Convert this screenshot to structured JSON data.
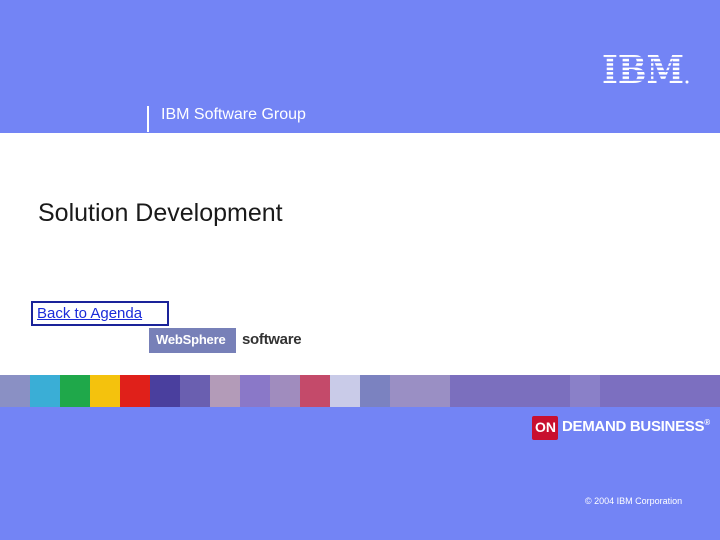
{
  "header": {
    "brand": "IBM",
    "group_label": "IBM Software Group"
  },
  "slide": {
    "title": "Solution Development",
    "agenda_link": "Back to Agenda"
  },
  "websphere_logo": {
    "brand": "WebSphere",
    "suffix": "software"
  },
  "ondemand_logo": {
    "badge": "ON",
    "text": "DEMAND BUSINESS",
    "mark": "®"
  },
  "footer": {
    "copyright": "© 2004 IBM Corporation"
  },
  "colors": {
    "background_blue": "#7384f5",
    "panel_white": "#ffffff",
    "link_blue": "#1a2bd9",
    "ondemand_red": "#c8102e"
  },
  "icons": [
    "ibm-logo-icon",
    "websphere-logo-icon",
    "ondemand-logo-icon"
  ]
}
